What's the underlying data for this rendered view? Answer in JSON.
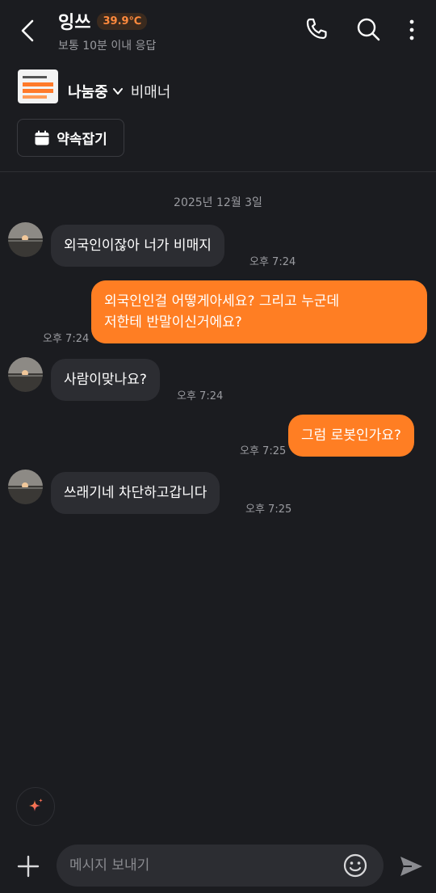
{
  "header": {
    "title": "잉쓰",
    "temperature": "39.9℃",
    "subtitle": "보통 10분 이내 응답"
  },
  "product": {
    "status": "나눔중",
    "title": "비매너"
  },
  "appointment_label": "약속잡기",
  "date_label": "2025년 12월 3일",
  "messages": [
    {
      "side": "in",
      "text": "외국인이잖아 너가 비매지",
      "time": "오후 7:24"
    },
    {
      "side": "out",
      "lines": [
        "외국인인걸 어떻게아세요? 그리고 누군데",
        "저한테 반말이신거에요?"
      ],
      "time": "오후 7:24"
    },
    {
      "side": "in",
      "text": "사람이맞나요?",
      "time": "오후 7:24"
    },
    {
      "side": "out",
      "text": "그럼 로봇인가요?",
      "time": "오후 7:25"
    },
    {
      "side": "in",
      "text": "쓰래기네 차단하고갑니다",
      "time": "오후 7:25"
    }
  ],
  "composer": {
    "placeholder": "메시지 보내기"
  },
  "icons": {
    "back": "back-arrow-icon",
    "call": "phone-icon",
    "search": "search-icon",
    "more": "more-vertical-icon",
    "calendar": "calendar-icon",
    "ai": "sparkle-icon",
    "plus": "plus-icon",
    "emoji": "emoji-icon",
    "send": "send-icon"
  },
  "colors": {
    "background": "#1b1c20",
    "accent": "#ff7e23",
    "incoming_bubble": "#2c2d32",
    "muted_text": "#9a9ba0"
  }
}
